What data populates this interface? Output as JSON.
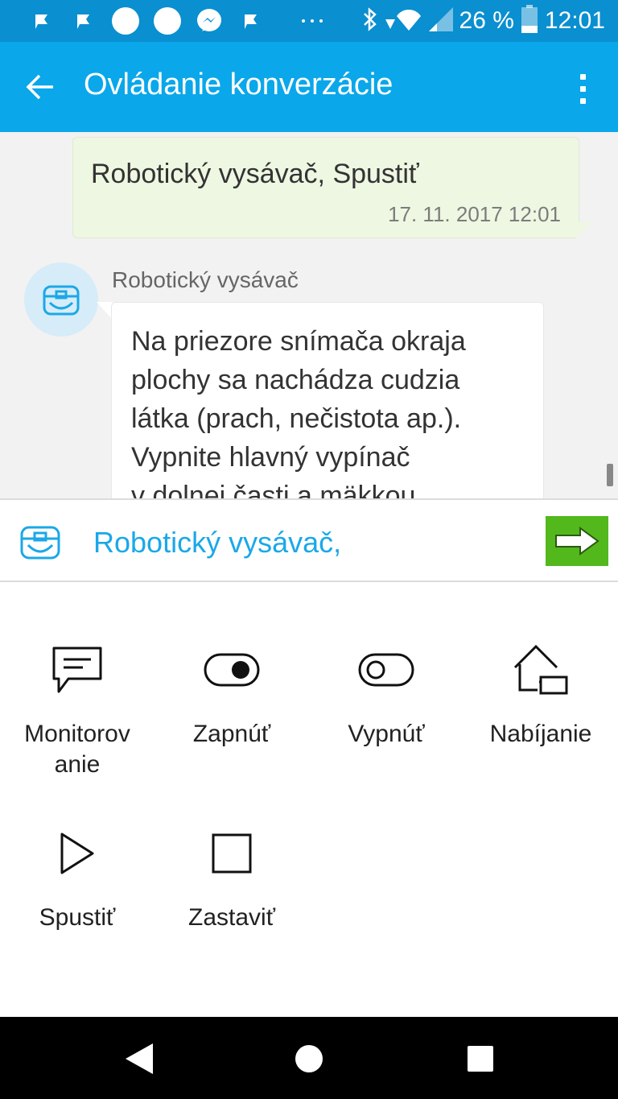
{
  "status_bar": {
    "battery_text": "26 %",
    "time": "12:01",
    "notification_icons": [
      "flag-icon",
      "flag-icon",
      "circle-icon",
      "circle-icon",
      "messenger-icon",
      "flag-icon",
      "more-dots-icon"
    ],
    "system_icons": [
      "bluetooth-icon",
      "wifi-icon",
      "signal-icon",
      "battery-icon"
    ]
  },
  "app_bar": {
    "title": "Ovládanie konverzácie"
  },
  "chat": {
    "sent": {
      "text": "Robotický vysávač, Spustiť",
      "timestamp": "17. 11. 2017 12:01"
    },
    "received": {
      "sender": "Robotický vysávač",
      "lines": [
        "Na priezore snímača okraja",
        "plochy sa nachádza cudzia",
        "látka (prach, nečistota ap.).",
        "Vypnite hlavný vypínač",
        "v dolnej časti a mäkkou"
      ]
    }
  },
  "input": {
    "text": "Robotický vysávač,"
  },
  "commands": [
    {
      "label": "Monitorov anie",
      "icon": "chat-bubble-icon"
    },
    {
      "label": "Zapnúť",
      "icon": "toggle-on-icon"
    },
    {
      "label": "Vypnúť",
      "icon": "toggle-off-icon"
    },
    {
      "label": "Nabíjanie",
      "icon": "home-charging-icon"
    },
    {
      "label": "Spustiť",
      "icon": "play-icon"
    },
    {
      "label": "Zastaviť",
      "icon": "stop-icon"
    }
  ],
  "colors": {
    "status_bar": "#0a8fd0",
    "app_bar": "#0aa7ea",
    "accent_text": "#1aa8e8",
    "send_button": "#52b81c",
    "sent_bubble": "#eef7e2",
    "chat_background": "#f2f2f2"
  }
}
